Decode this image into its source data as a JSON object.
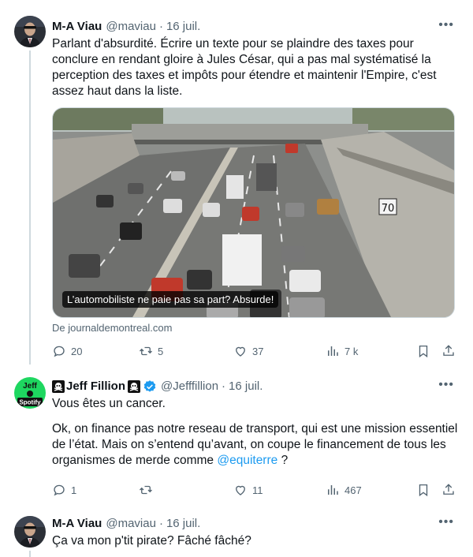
{
  "tweets": [
    {
      "name": "M-A Viau",
      "handle": "@maviau",
      "date": "16 juil.",
      "text": "Parlant d'absurdité. Écrire un texte pour se plaindre des taxes pour conclure en rendant gloire à Jules César, qui a pas mal systématisé la perception des taxes et impôts pour étendre et maintenir l'Empire, c'est assez haut dans la liste.",
      "card": {
        "caption": "L’automobiliste ne paie pas sa part? Absurde!",
        "source": "De journaldemontreal.com",
        "sign_text": "70"
      },
      "actions": {
        "replies": "20",
        "retweets": "5",
        "likes": "37",
        "views": "7 k"
      }
    },
    {
      "name": "Jeff Fillion",
      "handle": "@Jefffillion",
      "date": "16 juil.",
      "avatar_text_top": "Jeff",
      "avatar_text_bottom": "Spotify",
      "text_line1": "Vous êtes un cancer.",
      "text_para2": "Ok, on finance pas notre reseau de transport, qui est une mission essentiel de l’état. Mais on s’entend qu’avant, on coupe le financement de tous les organismes de merde comme ",
      "mention": "@equiterre",
      "text_after_mention": " ?",
      "actions": {
        "replies": "1",
        "retweets": "",
        "likes": "11",
        "views": "467"
      }
    },
    {
      "name": "M-A Viau",
      "handle": "@maviau",
      "date": "16 juil.",
      "text": "Ça va mon p'tit pirate? Fâché fâché?"
    }
  ],
  "colors": {
    "link": "#1d9bf0",
    "muted": "#536471",
    "verified": "#1d9bf0",
    "line": "#cfd9de"
  },
  "icons": [
    "reply-icon",
    "retweet-icon",
    "like-icon",
    "views-icon",
    "bookmark-icon",
    "share-icon",
    "more-icon",
    "verified-icon",
    "skull-icon"
  ]
}
